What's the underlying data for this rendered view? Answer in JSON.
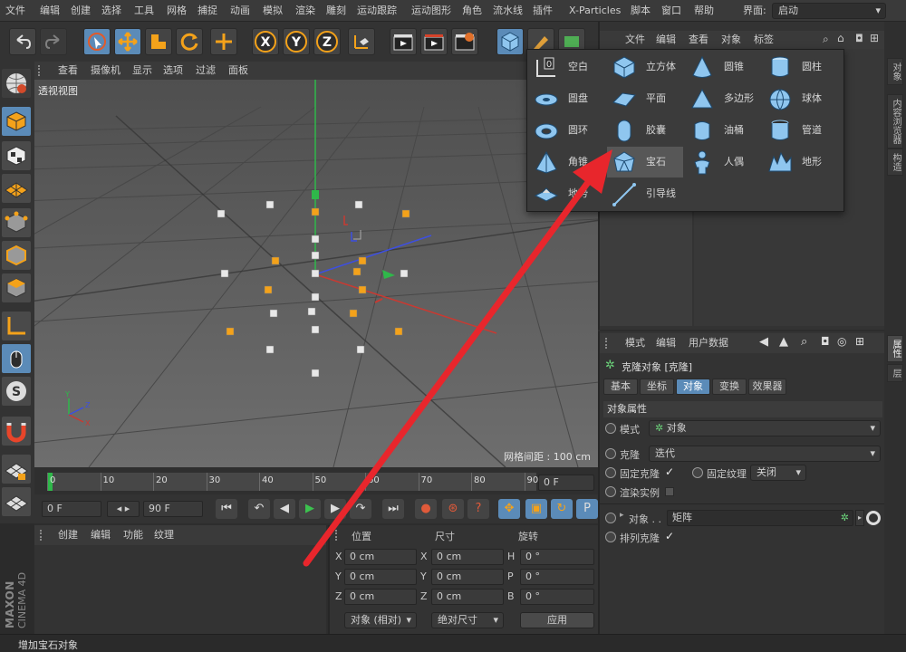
{
  "menubar": {
    "items": [
      "文件",
      "编辑",
      "创建",
      "选择",
      "工具",
      "网格",
      "捕捉",
      "动画",
      "模拟",
      "渲染",
      "雕刻",
      "运动跟踪",
      "运动图形",
      "角色",
      "流水线",
      "插件",
      "X-Particles",
      "脚本",
      "窗口",
      "帮助"
    ],
    "layout_label": "界面:",
    "layout_value": "启动"
  },
  "viewport": {
    "menu": [
      "查看",
      "摄像机",
      "显示",
      "选项",
      "过滤",
      "面板"
    ],
    "title": "透视视图",
    "grid_spacing": "网格间距 : 100 cm"
  },
  "timeline": {
    "ticks": [
      "0",
      "10",
      "20",
      "30",
      "40",
      "50",
      "60",
      "70",
      "80",
      "90"
    ],
    "current_frame": "0 F",
    "start_frame": "0 F",
    "end_frame": "90 F"
  },
  "objects_panel": {
    "menu": [
      "文件",
      "编辑",
      "查看",
      "对象",
      "标签"
    ]
  },
  "shape_popup": {
    "items": [
      {
        "label": "空白",
        "icon": "null-icon"
      },
      {
        "label": "立方体",
        "icon": "cube-icon"
      },
      {
        "label": "圆锥",
        "icon": "cone-icon"
      },
      {
        "label": "圆柱",
        "icon": "cylinder-icon"
      },
      {
        "label": "圆盘",
        "icon": "disc-icon"
      },
      {
        "label": "平面",
        "icon": "plane-icon"
      },
      {
        "label": "多边形",
        "icon": "polygon-icon"
      },
      {
        "label": "球体",
        "icon": "sphere-icon"
      },
      {
        "label": "圆环",
        "icon": "torus-icon"
      },
      {
        "label": "胶囊",
        "icon": "capsule-icon"
      },
      {
        "label": "油桶",
        "icon": "oil-tank-icon"
      },
      {
        "label": "管道",
        "icon": "tube-icon"
      },
      {
        "label": "角锥",
        "icon": "pyramid-icon"
      },
      {
        "label": "宝石",
        "icon": "platonic-icon"
      },
      {
        "label": "人偶",
        "icon": "figure-icon"
      },
      {
        "label": "地形",
        "icon": "landscape-icon"
      },
      {
        "label": "地势",
        "icon": "relief-icon"
      },
      {
        "label": "引导线",
        "icon": "guide-icon"
      }
    ]
  },
  "attributes": {
    "menu": [
      "模式",
      "编辑",
      "用户数据"
    ],
    "object_title": "克隆对象 [克隆]",
    "tabs": [
      "基本",
      "坐标",
      "对象",
      "变换",
      "效果器"
    ],
    "active_tab": "对象",
    "section": "对象属性",
    "mode_label": "模式",
    "mode_value": "对象",
    "clone_label": "克隆",
    "clone_value": "迭代",
    "fix_clone_label": "固定克隆",
    "fix_texture_label": "固定纹理",
    "fix_texture_value": "关闭",
    "render_instances_label": "渲染实例",
    "object_label": "对象 . .",
    "object_value": "矩阵",
    "sort_clones_label": "排列克隆"
  },
  "right_vtabs": [
    "对象",
    "内容浏览器",
    "构造"
  ],
  "right_vtabs2": [
    "属性",
    "层"
  ],
  "bottom_left": {
    "menu": [
      "创建",
      "编辑",
      "功能",
      "纹理"
    ]
  },
  "coords": {
    "headers": [
      "位置",
      "尺寸",
      "旋转"
    ],
    "rows": [
      {
        "a": "X",
        "pos": "0 cm",
        "b": "X",
        "size": "0 cm",
        "c": "H",
        "rot": "0 °"
      },
      {
        "a": "Y",
        "pos": "0 cm",
        "b": "Y",
        "size": "0 cm",
        "c": "P",
        "rot": "0 °"
      },
      {
        "a": "Z",
        "pos": "0 cm",
        "b": "Z",
        "size": "0 cm",
        "c": "B",
        "rot": "0 °"
      }
    ],
    "mode1": "对象 (相对)",
    "mode2": "绝对尺寸",
    "apply": "应用"
  },
  "statusbar": {
    "text": "增加宝石对象"
  },
  "brand": {
    "line1": "MAXON",
    "line2": "CINEMA 4D"
  },
  "colors": {
    "accent": "#5b8bb8",
    "arrow": "#e8262c",
    "bg": "#2d2d2d"
  }
}
